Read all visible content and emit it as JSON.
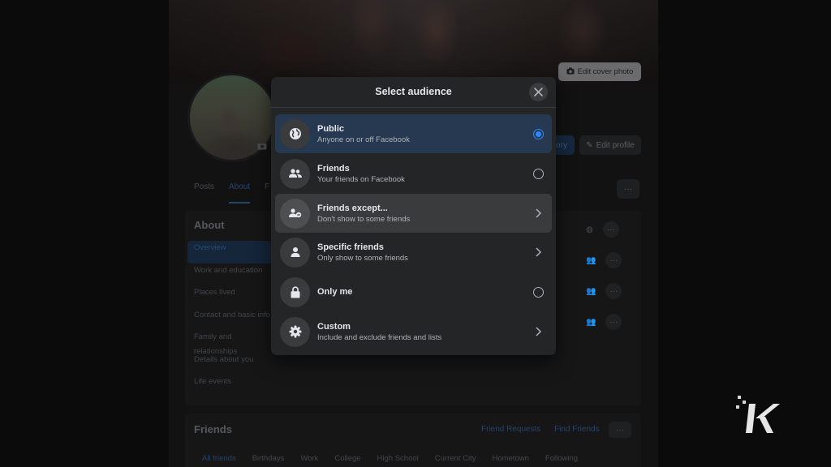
{
  "background": {
    "edit_cover_label": "Edit cover photo",
    "edit_profile_label": "Edit profile",
    "story_label": "ory",
    "more_label": "···",
    "tabs": [
      "Posts",
      "About",
      "F"
    ],
    "about": {
      "title": "About",
      "nav": [
        "Overview",
        "Work and education",
        "Places lived",
        "Contact and basic info",
        "Family and relationships",
        "Details about you",
        "Life events"
      ]
    },
    "friends": {
      "title": "Friends",
      "requests_label": "Friend Requests",
      "find_label": "Find Friends",
      "filters": [
        "All friends",
        "Birthdays",
        "Work",
        "College",
        "High School",
        "Current City",
        "Hometown",
        "Following"
      ]
    }
  },
  "modal": {
    "title": "Select audience",
    "options": [
      {
        "title": "Public",
        "desc": "Anyone on or off Facebook",
        "icon": "globe-icon",
        "control": "radio-selected"
      },
      {
        "title": "Friends",
        "desc": "Your friends on Facebook",
        "icon": "friends-icon",
        "control": "radio"
      },
      {
        "title": "Friends except...",
        "desc": "Don't show to some friends",
        "icon": "friends-except-icon",
        "control": "chevron"
      },
      {
        "title": "Specific friends",
        "desc": "Only show to some friends",
        "icon": "person-icon",
        "control": "chevron"
      },
      {
        "title": "Only me",
        "desc": "",
        "icon": "lock-icon",
        "control": "radio"
      },
      {
        "title": "Custom",
        "desc": "Include and exclude friends and lists",
        "icon": "gear-icon",
        "control": "chevron"
      }
    ]
  },
  "colors": {
    "accent": "#2d88ff",
    "modal_bg": "#242526",
    "selected_row": "#263951"
  }
}
